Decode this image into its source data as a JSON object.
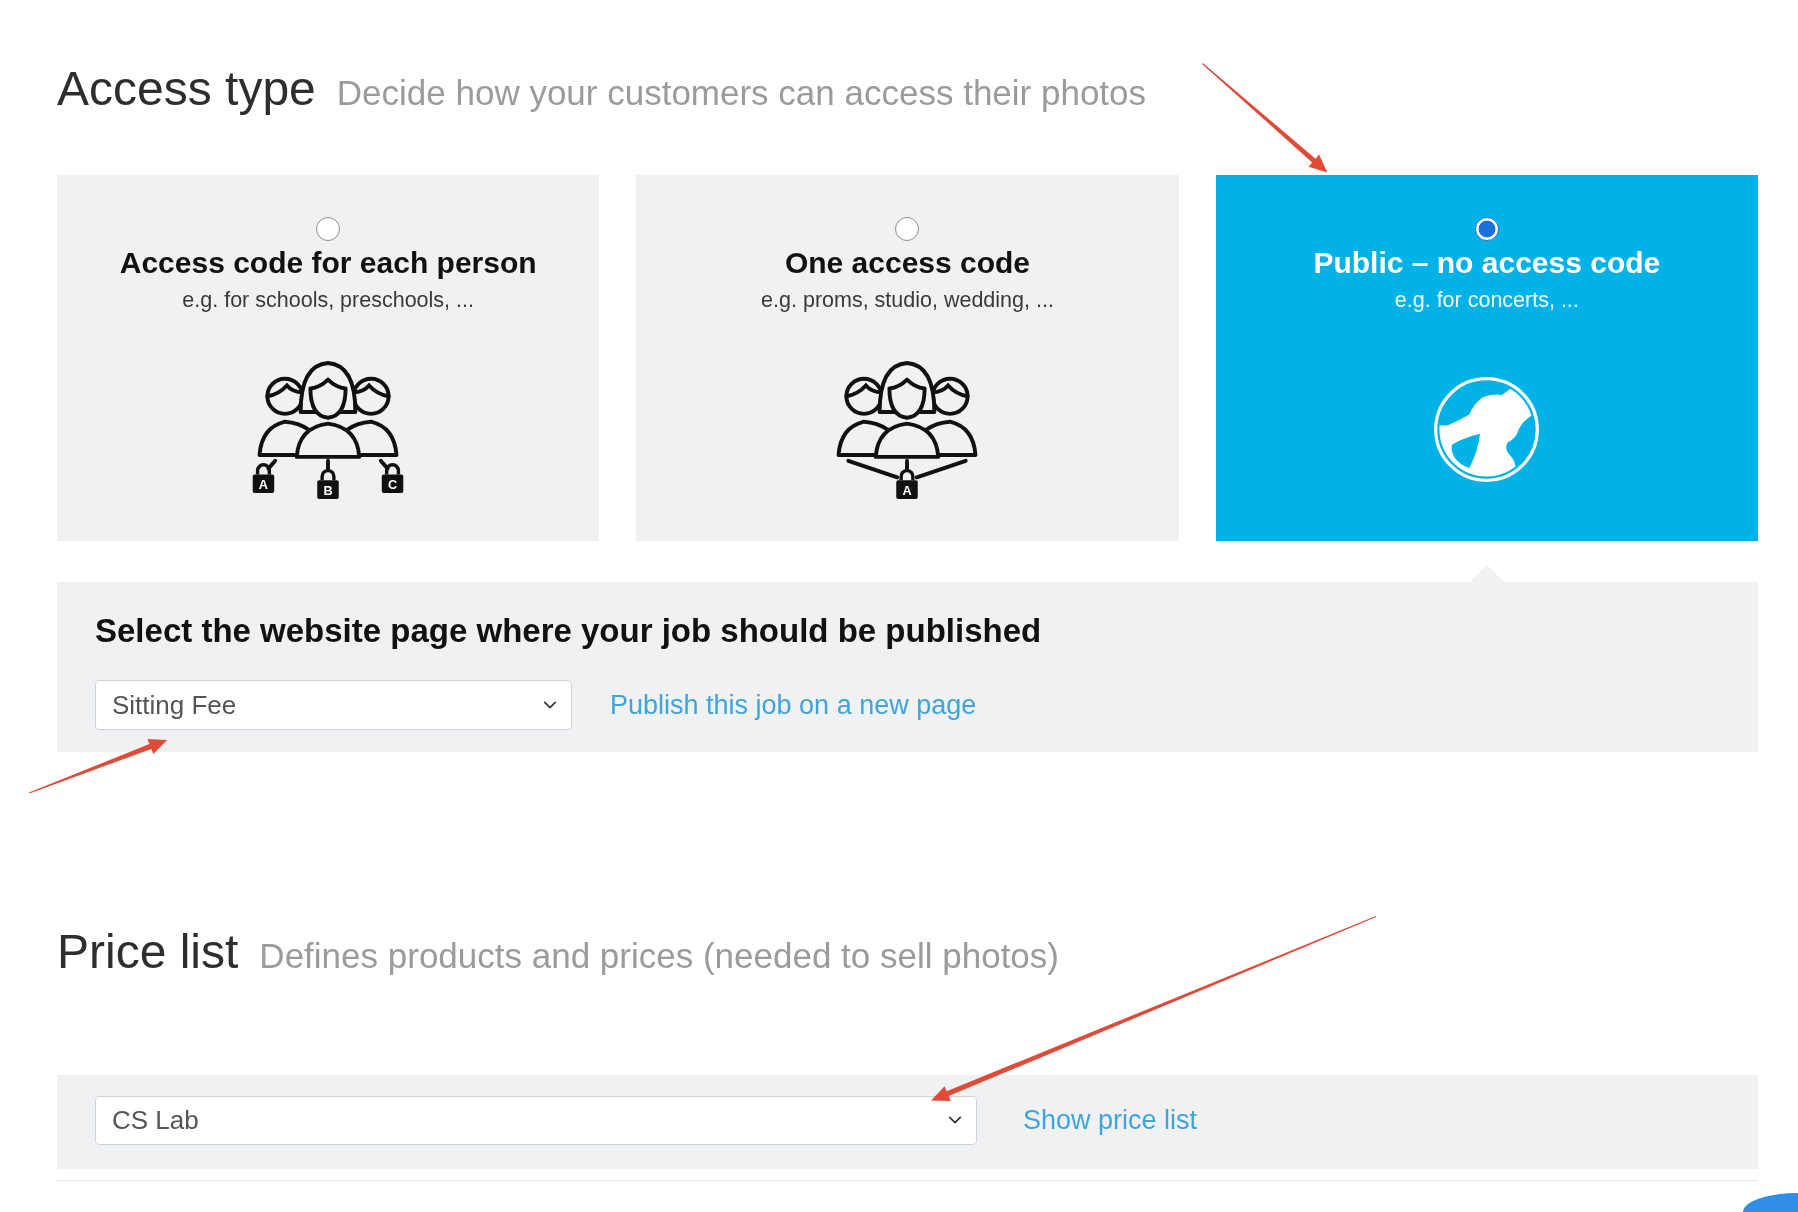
{
  "access_type": {
    "heading": "Access type",
    "description": "Decide how your customers can access their photos",
    "options": [
      {
        "title": "Access code for each person",
        "subtitle": "e.g. for schools, preschools, ...",
        "selected": false,
        "illustration": {
          "kind": "people",
          "locks": [
            "A",
            "B",
            "C"
          ]
        }
      },
      {
        "title": "One access code",
        "subtitle": "e.g. proms, studio, wedding, ...",
        "selected": false,
        "illustration": {
          "kind": "people",
          "locks": [
            "A"
          ]
        }
      },
      {
        "title": "Public – no access code",
        "subtitle": "e.g. for concerts, ...",
        "selected": true,
        "illustration": {
          "kind": "globe"
        }
      }
    ],
    "publish_panel": {
      "title": "Select the website page where your job should be published",
      "page_select": {
        "value": "Sitting Fee"
      },
      "link": "Publish this job on a new page"
    }
  },
  "price_list": {
    "heading": "Price list",
    "description": "Defines products and prices (needed to sell photos)",
    "select": {
      "value": "CS Lab"
    },
    "link": "Show price list"
  }
}
